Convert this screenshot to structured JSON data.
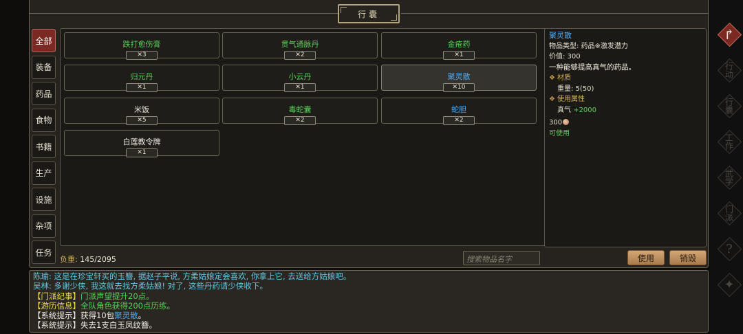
{
  "panel_title": "行囊",
  "tabs": [
    {
      "label": "全部",
      "active": true
    },
    {
      "label": "装备",
      "active": false
    },
    {
      "label": "药品",
      "active": false
    },
    {
      "label": "食物",
      "active": false
    },
    {
      "label": "书籍",
      "active": false
    },
    {
      "label": "生产",
      "active": false
    },
    {
      "label": "设施",
      "active": false
    },
    {
      "label": "杂项",
      "active": false
    },
    {
      "label": "任务",
      "active": false
    }
  ],
  "items": [
    {
      "name": "跌打愈伤膏",
      "qty": "✕3",
      "color": "green"
    },
    {
      "name": "贯气通脉丹",
      "qty": "✕2",
      "color": "green"
    },
    {
      "name": "金疮药",
      "qty": "✕1",
      "color": "green"
    },
    {
      "name": "归元丹",
      "qty": "✕1",
      "color": "green"
    },
    {
      "name": "小云丹",
      "qty": "✕1",
      "color": "green"
    },
    {
      "name": "聚灵散",
      "qty": "✕10",
      "color": "blue",
      "selected": true
    },
    {
      "name": "米饭",
      "qty": "✕5",
      "color": "white"
    },
    {
      "name": "毒蛇囊",
      "qty": "✕2",
      "color": "green"
    },
    {
      "name": "蛇胆",
      "qty": "✕2",
      "color": "blue"
    },
    {
      "name": "白莲教令牌",
      "qty": "✕1",
      "color": "white"
    }
  ],
  "load": {
    "label": "负重:",
    "value": "145/2095"
  },
  "search": {
    "placeholder": "搜索物品名字"
  },
  "buttons": {
    "use": "使用",
    "destroy": "销毁"
  },
  "detail": {
    "name": "聚灵散",
    "type": "物品类型: 药品※激发潜力",
    "value": "价值: 300",
    "description": "一种能够提高真气的药品。",
    "material_header": "材质",
    "weight": "重量: 5(50)",
    "use_attr_header": "使用属性",
    "bonus_label": "真气",
    "bonus_value": "+2000",
    "price": "300",
    "usable": "可使用"
  },
  "log": [
    [
      {
        "t": "陈瑜: 这是在珍宝轩买的玉簪, 据赵子平说, 方柔姑娘定会喜欢, 你拿上它, 去送给方姑娘吧。",
        "c": "cyan"
      }
    ],
    [
      {
        "t": "吴林: 多谢少侠, 我这就去找方柔姑娘! 对了, 这些丹药请少侠收下。",
        "c": "cyan"
      }
    ],
    [
      {
        "t": "【门派纪事】",
        "c": "yellow"
      },
      {
        "t": "门派声望提升20点。",
        "c": "green"
      }
    ],
    [
      {
        "t": "【游历信息】",
        "c": "yellow"
      },
      {
        "t": "全队角色获得200点历练。",
        "c": "green"
      }
    ],
    [
      {
        "t": "【系统提示】获得10包",
        "c": "white"
      },
      {
        "t": "聚灵散",
        "c": "blue"
      },
      {
        "t": "。",
        "c": "white"
      }
    ],
    [
      {
        "t": "【系统提示】失去1支白玉凤纹簪。",
        "c": "white"
      }
    ]
  ],
  "side_menu": [
    {
      "glyph": "↱",
      "icon": "return-arrow-icon",
      "active": true
    },
    {
      "glyph": "行动",
      "icon": "action-icon"
    },
    {
      "glyph": "行囊",
      "icon": "bag-icon"
    },
    {
      "glyph": "工作",
      "icon": "work-icon"
    },
    {
      "glyph": "武学",
      "icon": "martial-arts-icon"
    },
    {
      "glyph": "门派",
      "icon": "sect-icon"
    },
    {
      "glyph": "?",
      "icon": "help-icon"
    },
    {
      "glyph": "✦",
      "icon": "settings-icon"
    }
  ]
}
